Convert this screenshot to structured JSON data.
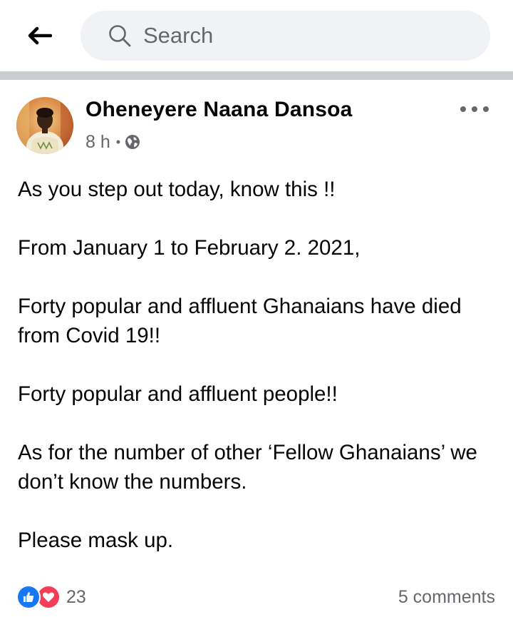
{
  "header": {
    "search_placeholder": "Search"
  },
  "post": {
    "author": "Oheneyere Naana Dansoa",
    "time": "8 h",
    "separator": "•",
    "privacy_icon": "globe-icon",
    "paragraphs": [
      "As you step out today, know this !!",
      "From January 1 to February 2. 2021,",
      "Forty popular and affluent Ghanaians have died from Covid 19!!",
      "Forty popular and affluent people!!",
      "As for the number of other ‘Fellow Ghanaians’ we don’t know the numbers.",
      "Please mask up."
    ],
    "reactions": {
      "icons": [
        "like-icon",
        "love-icon"
      ],
      "count": "23"
    },
    "comments_label": "5 comments"
  },
  "colors": {
    "like": "#1877f2",
    "love": "#f33e58",
    "secondary_text": "#65676b",
    "search_bg": "#f0f2f5",
    "divider": "#c9ccd1"
  }
}
